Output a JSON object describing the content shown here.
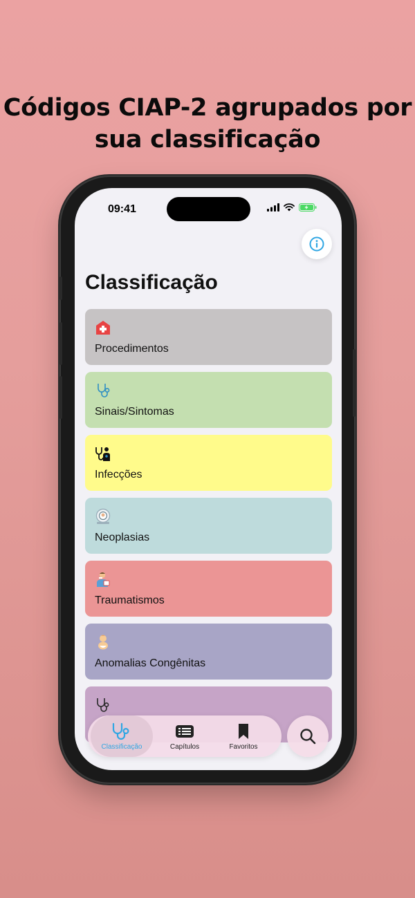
{
  "headline": {
    "line1": "Códigos CIAP-2 agrupados por",
    "line2": "sua classificação"
  },
  "status_bar": {
    "time": "09:41"
  },
  "page": {
    "title": "Classificação"
  },
  "categories": [
    {
      "label": "Procedimentos",
      "color": "#c6c3c4",
      "icon": "hospital-icon"
    },
    {
      "label": "Sinais/Sintomas",
      "color": "#c4dfb0",
      "icon": "stethoscope-icon"
    },
    {
      "label": "Infecções",
      "color": "#fffb8b",
      "icon": "doctor-icon"
    },
    {
      "label": "Neoplasias",
      "color": "#bedbdc",
      "icon": "mri-scanner-icon"
    },
    {
      "label": "Traumatismos",
      "color": "#eb9595",
      "icon": "injured-person-icon"
    },
    {
      "label": "Anomalias Congênitas",
      "color": "#a8a5c6",
      "icon": "baby-icon"
    },
    {
      "label": "",
      "color": "#c6a4c7",
      "icon": "stethoscope-icon"
    }
  ],
  "tabbar": {
    "tabs": [
      {
        "label": "Classificação",
        "icon": "stethoscope-icon",
        "active": true
      },
      {
        "label": "Capítulos",
        "icon": "list-icon",
        "active": false
      },
      {
        "label": "Favoritos",
        "icon": "bookmark-icon",
        "active": false
      }
    ],
    "search_icon": "search-icon"
  },
  "colors": {
    "accent": "#2fa6e3",
    "background": "#e59e9c"
  }
}
